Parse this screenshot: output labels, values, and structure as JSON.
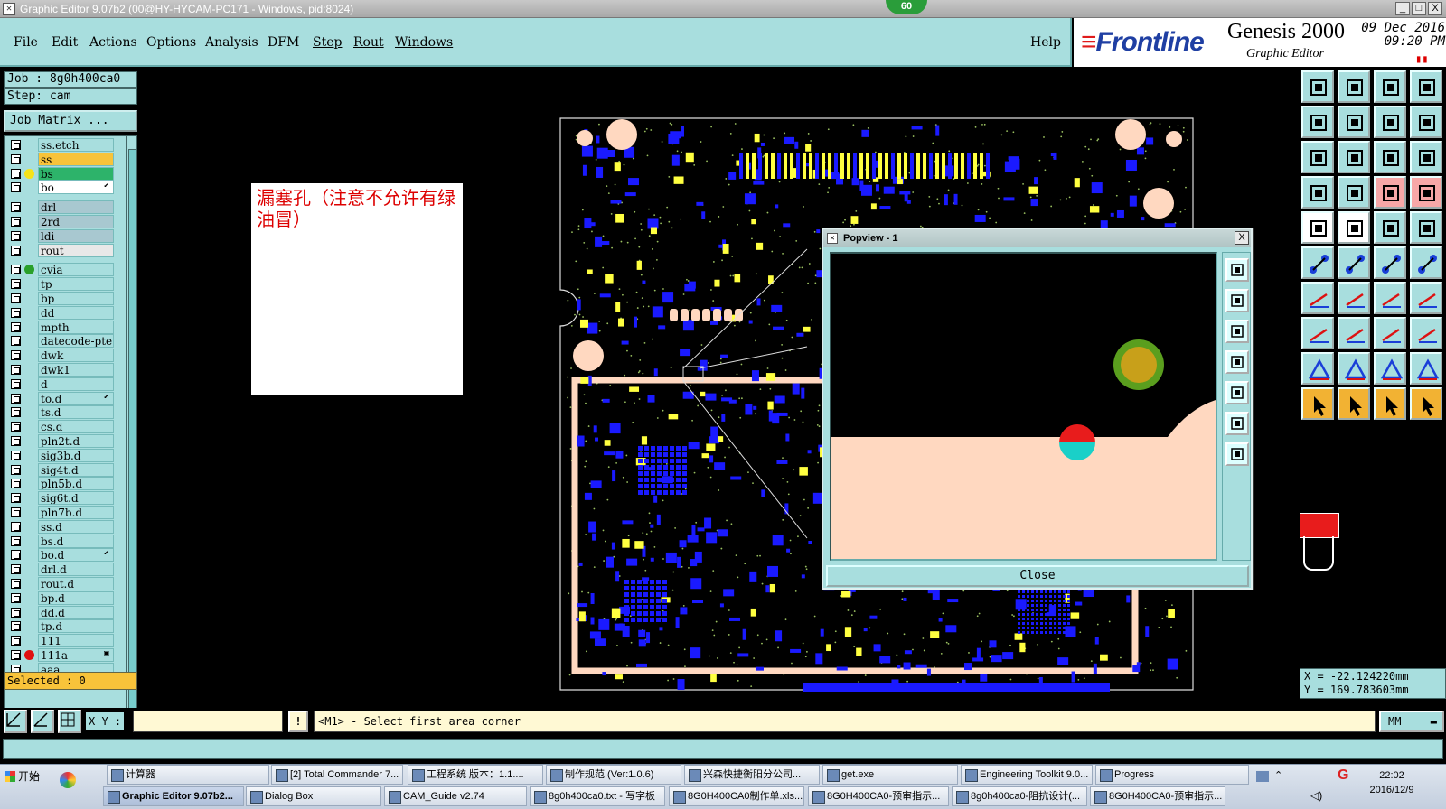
{
  "window": {
    "title": "Graphic Editor 9.07b2 (00@HY-HYCAM-PC171 - Windows, pid:8024)",
    "badge": "60",
    "minimize": "_",
    "maximize": "□",
    "close": "X"
  },
  "menu": {
    "items": [
      "File",
      "Edit",
      "Actions",
      "Options",
      "Analysis",
      "DFM",
      "Step",
      "Rout",
      "Windows"
    ],
    "help": "Help"
  },
  "brand": {
    "logo": "Frontline",
    "product": "Genesis 2000",
    "subtitle": "Graphic Editor",
    "date": "09 Dec 2016",
    "time": "09:20 PM"
  },
  "job": {
    "job_label": "Job : 8g0h400ca0",
    "step_label": "Step: cam",
    "matrix_button": "Job Matrix ..."
  },
  "layers": [
    {
      "name": "ss.etch",
      "color": "#a8dede",
      "dot": ""
    },
    {
      "name": "ss",
      "color": "#f8c33a",
      "dot": ""
    },
    {
      "name": "bs",
      "color": "#2db36a",
      "dot": "#f5e31a"
    },
    {
      "name": "bo",
      "color": "#ffffff",
      "dot": "",
      "mark": "⬋"
    },
    {
      "name": "drl",
      "color": "#a8c8d0",
      "dot": ""
    },
    {
      "name": "2rd",
      "color": "#a8c8d0",
      "dot": ""
    },
    {
      "name": "ldi",
      "color": "#a8c8d0",
      "dot": ""
    },
    {
      "name": "rout",
      "color": "#e8e8e8",
      "dot": ""
    },
    {
      "name": "cvia",
      "color": "#a8dede",
      "dot": "#2aa02a"
    },
    {
      "name": "tp",
      "color": "#a8dede",
      "dot": ""
    },
    {
      "name": "bp",
      "color": "#a8dede",
      "dot": ""
    },
    {
      "name": "dd",
      "color": "#a8dede",
      "dot": ""
    },
    {
      "name": "mpth",
      "color": "#a8dede",
      "dot": ""
    },
    {
      "name": "datecode-pte",
      "color": "#a8dede",
      "dot": ""
    },
    {
      "name": "dwk",
      "color": "#a8dede",
      "dot": ""
    },
    {
      "name": "dwk1",
      "color": "#a8dede",
      "dot": ""
    },
    {
      "name": "d",
      "color": "#a8dede",
      "dot": ""
    },
    {
      "name": "to.d",
      "color": "#a8dede",
      "dot": "",
      "mark": "⬋"
    },
    {
      "name": "ts.d",
      "color": "#a8dede",
      "dot": ""
    },
    {
      "name": "cs.d",
      "color": "#a8dede",
      "dot": ""
    },
    {
      "name": "pln2t.d",
      "color": "#a8dede",
      "dot": ""
    },
    {
      "name": "sig3b.d",
      "color": "#a8dede",
      "dot": ""
    },
    {
      "name": "sig4t.d",
      "color": "#a8dede",
      "dot": ""
    },
    {
      "name": "pln5b.d",
      "color": "#a8dede",
      "dot": ""
    },
    {
      "name": "sig6t.d",
      "color": "#a8dede",
      "dot": ""
    },
    {
      "name": "pln7b.d",
      "color": "#a8dede",
      "dot": ""
    },
    {
      "name": "ss.d",
      "color": "#a8dede",
      "dot": ""
    },
    {
      "name": "bs.d",
      "color": "#a8dede",
      "dot": ""
    },
    {
      "name": "bo.d",
      "color": "#a8dede",
      "dot": "",
      "mark": "⬋"
    },
    {
      "name": "drl.d",
      "color": "#a8dede",
      "dot": ""
    },
    {
      "name": "rout.d",
      "color": "#a8dede",
      "dot": ""
    },
    {
      "name": "bp.d",
      "color": "#a8dede",
      "dot": ""
    },
    {
      "name": "dd.d",
      "color": "#a8dede",
      "dot": ""
    },
    {
      "name": "tp.d",
      "color": "#a8dede",
      "dot": ""
    },
    {
      "name": "111",
      "color": "#a8dede",
      "dot": ""
    },
    {
      "name": "111a",
      "color": "#a8dede",
      "dot": "#e01010",
      "mark": "▣"
    },
    {
      "name": "aaa",
      "color": "#a8dede",
      "dot": ""
    }
  ],
  "selected": "Selected : 0",
  "note": "漏塞孔（注意不允许有绿油冒）",
  "popview": {
    "title": "Popview - 1",
    "close_label": "Close",
    "close_x": "X"
  },
  "coords": {
    "x": "X = -22.124220mm",
    "y": "Y = 169.783603mm"
  },
  "status": {
    "xy_label": "X Y :",
    "xy_value": "",
    "warn": "!",
    "message": "<M1> - Select first area corner",
    "units": "MM"
  },
  "taskbar": {
    "start": "开始",
    "row1": [
      "计算器",
      "[2] Total Commander 7...",
      "工程系统  版本：1.1....",
      "制作规范 (Ver:1.0.6)",
      "兴森快捷衡阳分公司...",
      "get.exe",
      "Engineering Toolkit 9.0...",
      "Progress"
    ],
    "row2": [
      "Graphic Editor 9.07b2...",
      "Dialog Box",
      "CAM_Guide v2.74",
      "8g0h400ca0.txt - 写字板",
      "8G0H400CA0制作单.xls...",
      "8G0H400CA0-预审指示...",
      "8g0h400ca0-阻抗设计(...",
      "8G0H400CA0-预审指示..."
    ],
    "clock_time": "22:02",
    "clock_date": "2016/12/9"
  },
  "colors": {
    "panel": "#a8dede",
    "pcb_pad": "#1a1aff",
    "pcb_yellow": "#ffff40",
    "pcb_outline": "#ffd8c0",
    "note_text": "#dd0000"
  }
}
